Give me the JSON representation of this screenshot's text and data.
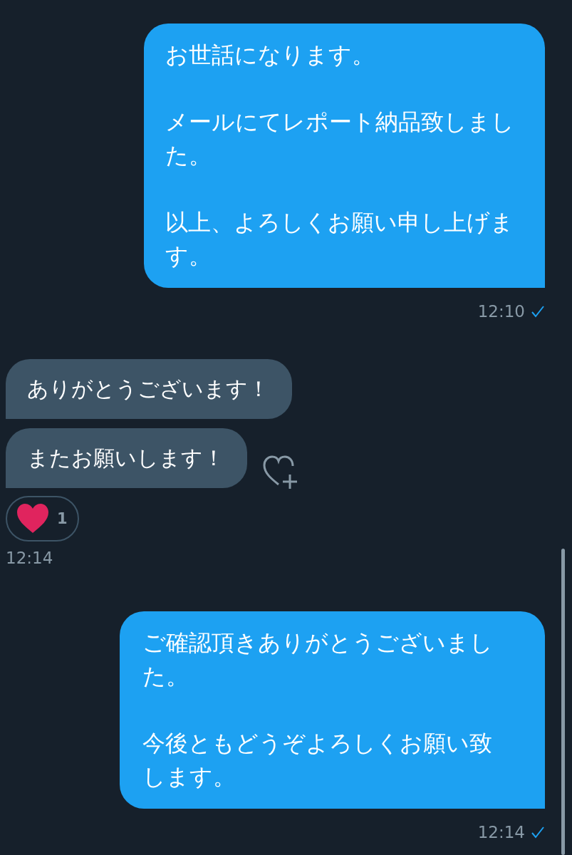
{
  "conversation": [
    {
      "kind": "outgoing",
      "bubbles": [
        [
          "お世話になります。",
          "メールにてレポート納品致しました。",
          "以上、よろしくお願い申し上げます。"
        ]
      ],
      "time": "12:10",
      "read": true
    },
    {
      "kind": "incoming",
      "bubbles": [
        [
          "ありがとうございます！"
        ],
        [
          "またお願いします！"
        ]
      ],
      "reaction_count": "1",
      "time": "12:14"
    },
    {
      "kind": "outgoing",
      "bubbles": [
        [
          "ご確認頂きありがとうございました。",
          "今後ともどうぞよろしくお願い致します。"
        ]
      ],
      "time": "12:14",
      "read": true
    }
  ]
}
